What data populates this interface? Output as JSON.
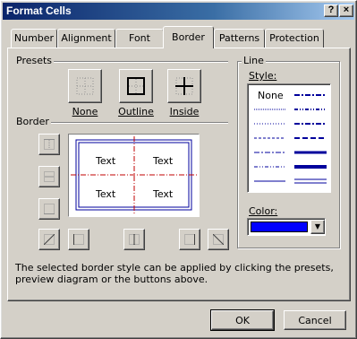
{
  "window": {
    "title": "Format Cells",
    "help_glyph": "?",
    "close_glyph": "×"
  },
  "tabs": [
    {
      "label": "Number"
    },
    {
      "label": "Alignment"
    },
    {
      "label": "Font"
    },
    {
      "label": "Border",
      "active": true
    },
    {
      "label": "Patterns"
    },
    {
      "label": "Protection"
    }
  ],
  "presets": {
    "heading": "Presets",
    "items": [
      {
        "label": "None",
        "icon": "preset-none-icon"
      },
      {
        "label": "Outline",
        "icon": "preset-outline-icon"
      },
      {
        "label": "Inside",
        "icon": "preset-inside-icon"
      }
    ]
  },
  "border": {
    "heading": "Border",
    "preview_cells": [
      "Text",
      "Text",
      "Text",
      "Text"
    ]
  },
  "line": {
    "heading": "Line",
    "style_label": "Style:",
    "none_label": "None",
    "color_label": "Color:",
    "selected_color": "#0000ff",
    "line_color": "#00009c"
  },
  "info_text": "The selected border style can be applied by clicking the presets, preview diagram or the buttons above.",
  "buttons": {
    "ok": "OK",
    "cancel": "Cancel"
  }
}
